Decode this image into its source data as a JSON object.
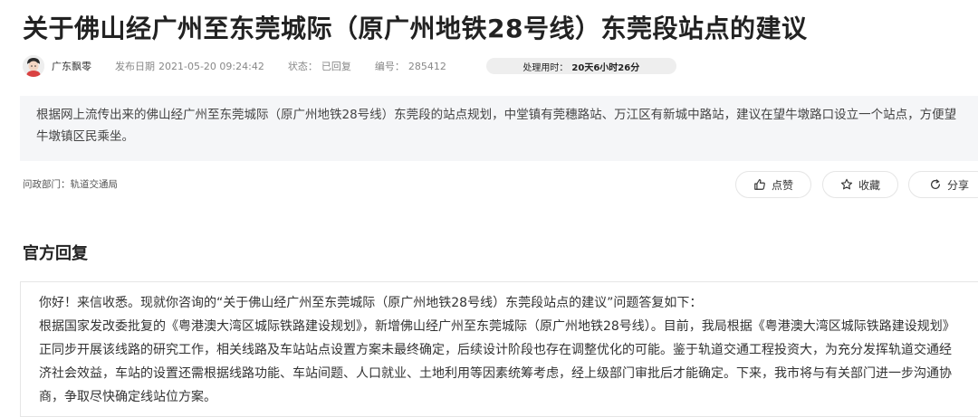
{
  "question": {
    "title": "关于佛山经广州至东莞城际（原广州地铁28号线）东莞段站点的建议",
    "author": "广东飘零",
    "publish_label": "发布日期",
    "publish_date": "2021-05-20 09:24:42",
    "status_label": "状态：",
    "status": "已回复",
    "number_label": "编号：",
    "number": "285412",
    "processing_label": "处理用时：",
    "processing_time": "20天6小时26分",
    "body": "根据网上流传出来的佛山经广州至东莞城际（原广州地铁28号线）东莞段的站点规划，中堂镇有莞穗路站、万江区有新城中路站，建议在望牛墩路口设立一个站点，方便望牛墩镇区民乘坐。",
    "dept_label": "问政部门：",
    "dept": "轨道交通局"
  },
  "actions": {
    "like": "点赞",
    "favorite": "收藏",
    "share": "分享"
  },
  "reply": {
    "heading": "官方回复",
    "greeting": "你好！来信收悉。现就你咨询的“关于佛山经广州至东莞城际（原广州地铁28号线）东莞段站点的建议”问题答复如下：",
    "body": "根据国家发改委批复的《粤港澳大湾区城际铁路建设规划》，新增佛山经广州至东莞城际（原广州地铁28号线）。目前，我局根据《粤港澳大湾区城际铁路建设规划》正同步开展该线路的研究工作，相关线路及车站站点设置方案未最终确定，后续设计阶段也存在调整优化的可能。鉴于轨道交通工程投资大，为充分发挥轨道交通经济社会效益，车站的设置还需根据线路功能、车站间题、人口就业、土地利用等因素统筹考虑，经上级部门审批后才能确定。下来，我市将与有关部门进一步沟通协商，争取尽快确定线站位方案。"
  },
  "icons": {
    "like": "thumbs-up-icon",
    "favorite": "star-icon",
    "share": "refresh-share-icon"
  }
}
